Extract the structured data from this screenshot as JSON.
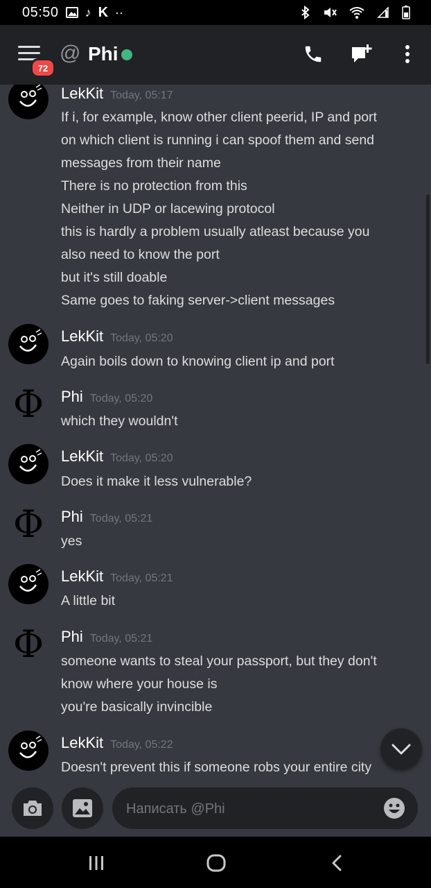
{
  "status_bar": {
    "time": "05:50",
    "icons_left": [
      "gallery-icon",
      "tiktok-icon",
      "k-icon",
      "more-dots-icon"
    ],
    "icons_right": [
      "bluetooth-icon",
      "mute-icon",
      "wifi-icon",
      "signal-icon",
      "battery-icon"
    ]
  },
  "header": {
    "badge_count": "72",
    "at_symbol": "@",
    "channel_name": "Phi",
    "status_color": "#43b581"
  },
  "messages": [
    {
      "author": "LekKit",
      "timestamp": "Today, 05:17",
      "avatar": "lekkit",
      "lines": [
        "If i, for example, know other client peerid, IP and port",
        "on which client is running i can spoof them and send",
        "messages from their name",
        "There is no protection from this",
        "Neither in UDP or lacewing protocol",
        "this is hardly a problem usually atleast because you",
        "also need to know the port",
        "but it's still doable",
        "Same goes to faking server->client messages"
      ]
    },
    {
      "author": "LekKit",
      "timestamp": "Today, 05:20",
      "avatar": "lekkit",
      "lines": [
        "Again boils down to knowing client ip and port"
      ]
    },
    {
      "author": "Phi",
      "timestamp": "Today, 05:20",
      "avatar": "phi",
      "lines": [
        "which they wouldn't"
      ]
    },
    {
      "author": "LekKit",
      "timestamp": "Today, 05:20",
      "avatar": "lekkit",
      "lines": [
        "Does it make it less vulnerable?"
      ]
    },
    {
      "author": "Phi",
      "timestamp": "Today, 05:21",
      "avatar": "phi",
      "lines": [
        "yes"
      ]
    },
    {
      "author": "LekKit",
      "timestamp": "Today, 05:21",
      "avatar": "lekkit",
      "lines": [
        "A little bit"
      ]
    },
    {
      "author": "Phi",
      "timestamp": "Today, 05:21",
      "avatar": "phi",
      "lines": [
        "someone wants to steal your passport, but they don't",
        "know where your house is",
        "you're basically invincible"
      ]
    },
    {
      "author": "LekKit",
      "timestamp": "Today, 05:22",
      "avatar": "lekkit",
      "lines": [
        "Doesn't prevent this if someone robs your entire city"
      ]
    }
  ],
  "composer": {
    "placeholder": "Написать @Phi"
  },
  "colors": {
    "background": "#36393f",
    "header": "#202225",
    "badge": "#f04747",
    "timestamp": "#72767d"
  }
}
